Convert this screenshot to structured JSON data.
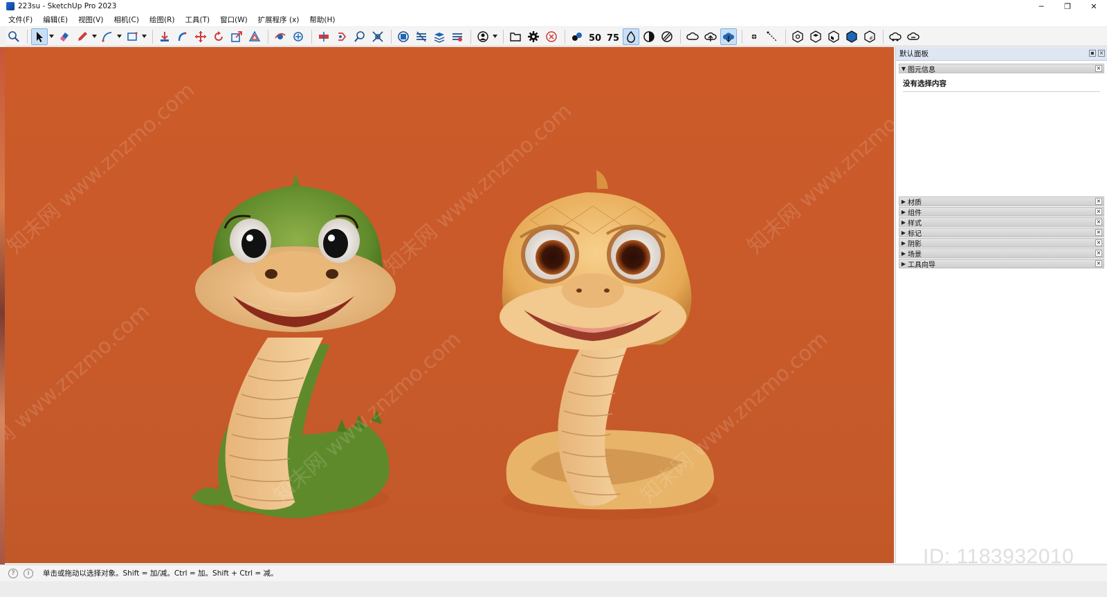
{
  "window": {
    "title": "223su - SketchUp Pro 2023",
    "controls": [
      "─",
      "❐",
      "✕"
    ]
  },
  "menu": [
    "文件(F)",
    "编辑(E)",
    "视图(V)",
    "相机(C)",
    "绘图(R)",
    "工具(T)",
    "窗口(W)",
    "扩展程序 (x)",
    "帮助(H)"
  ],
  "toolbar": {
    "icons": [
      "zoom-icon",
      "select-icon",
      "eraser-icon",
      "pencil-icon",
      "arc-icon",
      "rectangle-icon",
      "push-pull-icon",
      "follow-me-icon",
      "move-icon",
      "rotate-icon",
      "scale-icon",
      "offset-icon",
      "orbit-icon",
      "pan-icon",
      "zoom-window-icon",
      "zoom-extents-icon",
      "section-plane-icon",
      "section-display-icon",
      "layers-icon",
      "styles-icon",
      "person-icon",
      "open-folder-icon",
      "settings-gear-icon",
      "stop-icon",
      "binoculars-icon",
      "number-50-icon",
      "number-75-icon",
      "drop-icon",
      "contrast-icon",
      "hatch-icon",
      "cloud-sync-icon",
      "cloud-upload-icon",
      "cloud-download-icon",
      "point-icon",
      "dimension-icon",
      "view-top-icon",
      "view-front-icon",
      "view-right-icon",
      "view-iso-icon",
      "view-back-icon",
      "cloud-a-icon",
      "cloud-b-icon"
    ]
  },
  "tray": {
    "title": "默认面板",
    "entity_info": {
      "label": "图元信息",
      "content": "没有选择内容"
    },
    "panels": [
      "材质",
      "组件",
      "样式",
      "标记",
      "阴影",
      "场景",
      "工具向导"
    ]
  },
  "status": {
    "text": "单击或拖动以选择对象。Shift = 加/减。Ctrl = 加。Shift + Ctrl = 减。"
  },
  "watermark": {
    "logo": "知末",
    "id": "ID: 1183932010",
    "site": "知末网 www.znzmo.com"
  },
  "colors": {
    "viewport_bg": "#cc5b29",
    "tray_header": "#dde6f2",
    "active_tool": "#c9dff6"
  }
}
